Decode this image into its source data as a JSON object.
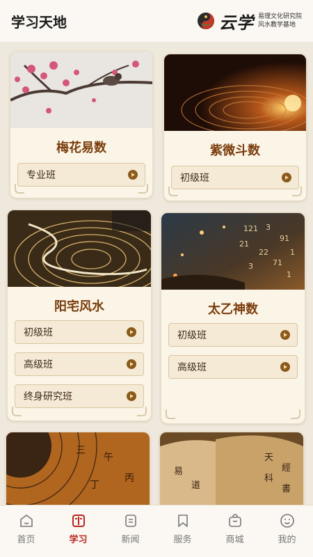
{
  "header": {
    "title": "学习天地",
    "brand": {
      "name": "云学",
      "line1": "易理文化研究院",
      "line2": "风水教学基地"
    }
  },
  "courses": [
    {
      "title": "梅花易数",
      "image_icon": "plum-blossom-bird-painting",
      "classes": [
        "专业班"
      ]
    },
    {
      "title": "紫微斗数",
      "image_icon": "glowing-compass-dial",
      "classes": [
        "初级班"
      ]
    },
    {
      "title": "阳宅风水",
      "image_icon": "luopan-compass",
      "classes": [
        "初级班",
        "高级班",
        "终身研究班"
      ]
    },
    {
      "title": "太乙神数",
      "image_icon": "cosmic-numbers",
      "classes": [
        "初级班",
        "高级班"
      ]
    },
    {
      "title": "",
      "image_icon": "golden-compass-closeup",
      "classes": []
    },
    {
      "title": "",
      "image_icon": "ancient-books-scrolls",
      "classes": []
    }
  ],
  "tabs": [
    {
      "label": "首页",
      "icon": "home-icon",
      "active": false
    },
    {
      "label": "学习",
      "icon": "book-icon",
      "active": true
    },
    {
      "label": "新闻",
      "icon": "news-icon",
      "active": false
    },
    {
      "label": "服务",
      "icon": "bookmark-icon",
      "active": false
    },
    {
      "label": "商城",
      "icon": "shop-icon",
      "active": false
    },
    {
      "label": "我的",
      "icon": "profile-icon",
      "active": false
    }
  ],
  "colors": {
    "accent": "#b8261f",
    "course_title": "#7a3d0c",
    "card_bg": "#fbf5e8",
    "page_bg": "#efe8dc"
  }
}
